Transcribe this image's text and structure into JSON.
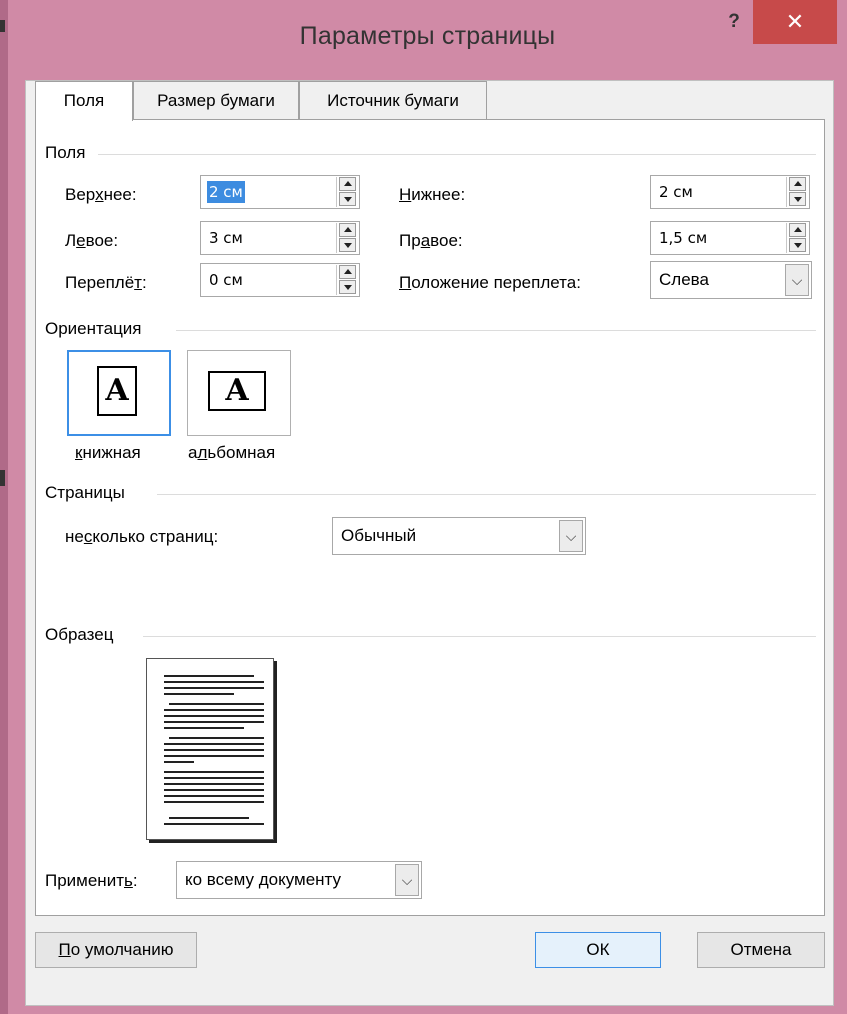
{
  "window": {
    "title": "Параметры страницы",
    "help_label": "?",
    "close_label": "✕"
  },
  "tabs": [
    {
      "label": "Поля",
      "active": true
    },
    {
      "label": "Размер бумаги",
      "active": false
    },
    {
      "label": "Источник бумаги",
      "active": false
    }
  ],
  "margins": {
    "section_label": "Поля",
    "top": {
      "label_pre": "Вер",
      "label_u": "х",
      "label_post": "нее:",
      "value": "2 см"
    },
    "left": {
      "label_pre": "Л",
      "label_u": "е",
      "label_post": "вое:",
      "value": "3 см"
    },
    "gutter": {
      "label_pre": "Переплё",
      "label_u": "т",
      "label_post": ":",
      "value": "0 см"
    },
    "bottom": {
      "label_pre": "",
      "label_u": "Н",
      "label_post": "ижнее:",
      "value": "2 см"
    },
    "right": {
      "label_pre": "Пр",
      "label_u": "а",
      "label_post": "вое:",
      "value": "1,5 см"
    },
    "gutter_position": {
      "label_pre": "",
      "label_u": "П",
      "label_post": "оложение переплета:",
      "value": "Слева"
    }
  },
  "orientation": {
    "section_label": "Ориентация",
    "glyph": "A",
    "portrait": {
      "label_pre": "",
      "label_u": "к",
      "label_post": "нижная"
    },
    "landscape": {
      "label_pre": "а",
      "label_u": "л",
      "label_post": "ьбомная"
    }
  },
  "pages": {
    "section_label": "Страницы",
    "multiple_label_pre": "не",
    "multiple_label_u": "с",
    "multiple_label_post": "колько страниц:",
    "multiple_value": "Обычный"
  },
  "preview": {
    "section_label": "Образец"
  },
  "apply": {
    "label_pre": "Применит",
    "label_u": "ь",
    "label_post": ":",
    "value": "ко всему документу"
  },
  "buttons": {
    "default_pre": "",
    "default_u": "П",
    "default_post": "о умолчанию",
    "ok": "ОК",
    "cancel": "Отмена"
  },
  "icons": {
    "help": "help-icon",
    "close": "close-icon",
    "spin_up": "spin-up-icon",
    "spin_down": "spin-down-icon",
    "dropdown": "chevron-down-icon"
  },
  "colors": {
    "title_bar": "#d08aa6",
    "close_button": "#c74a4a",
    "selection": "#3d8ce0",
    "focus_border": "#3c8fe6"
  }
}
